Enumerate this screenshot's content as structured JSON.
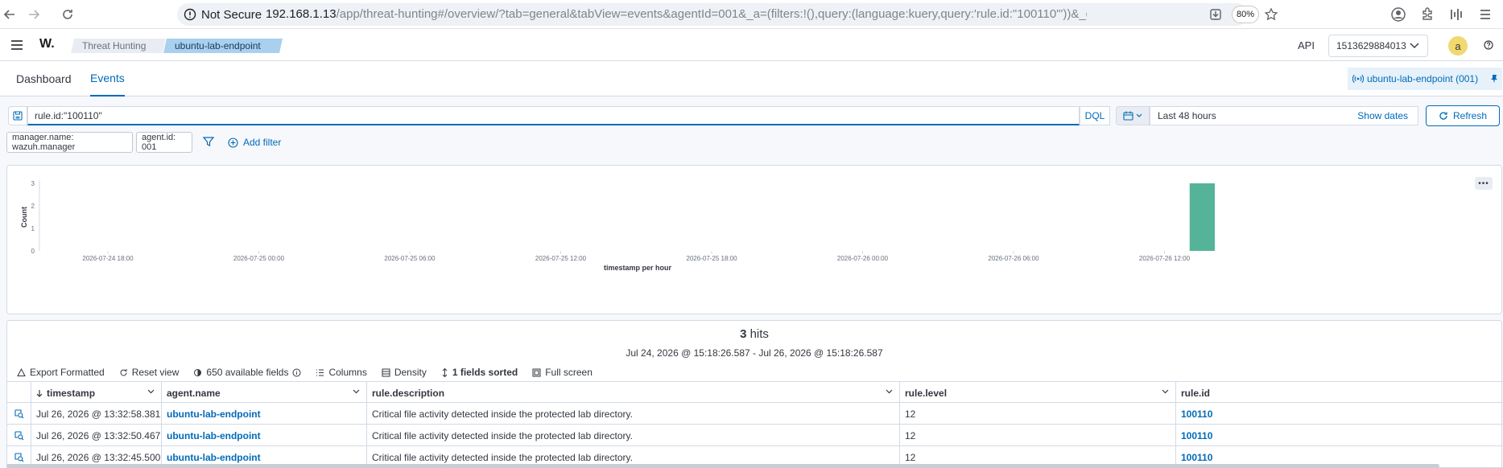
{
  "browser": {
    "security_label": "Not Secure",
    "url_host": "192.168.1.13",
    "url_path": "/app/threat-hunting#/overview/?tab=general&tabView=events&agentId=001&_a=(filters:!(),query:(language:kuery,query:'rule.id:\"100110\"'))&_g=(filters:!(),refreshInterval:(pause:!t",
    "zoom": "80%"
  },
  "header": {
    "logo": "W.",
    "breadcrumbs": [
      "Threat Hunting",
      "ubuntu-lab-endpoint"
    ],
    "api_label": "API",
    "tenant": "1513629884013",
    "avatar_initial": "a"
  },
  "tabs": [
    "Dashboard",
    "Events"
  ],
  "agent_pill": "ubuntu-lab-endpoint (001)",
  "query": {
    "value": "rule.id:\"100110\"",
    "language": "DQL",
    "date_range": "Last 48 hours",
    "show_dates": "Show dates",
    "refresh": "Refresh"
  },
  "filters": [
    "manager.name: wazuh.manager",
    "agent.id: 001"
  ],
  "add_filter": "Add filter",
  "chart_data": {
    "type": "bar",
    "x": [
      "2026-07-26 13:00"
    ],
    "values": [
      3
    ],
    "xlabel": "timestamp per hour",
    "ylabel": "Count",
    "ylim": [
      0,
      3
    ],
    "y_ticks": [
      "0",
      "1",
      "2",
      "3"
    ],
    "x_ticks": [
      "2026-07-24 18:00",
      "2026-07-25 00:00",
      "2026-07-25 06:00",
      "2026-07-25 12:00",
      "2026-07-25 18:00",
      "2026-07-26 00:00",
      "2026-07-26 06:00",
      "2026-07-26 12:00"
    ],
    "bar_color": "#54b399",
    "grid": false
  },
  "results": {
    "hits_count": "3",
    "hits_label": "hits",
    "range": "Jul 24, 2026 @ 15:18:26.587 - Jul 26, 2026 @ 15:18:26.587",
    "toolbar": {
      "export": "Export Formatted",
      "reset": "Reset view",
      "fields": "650 available fields",
      "columns": "Columns",
      "density": "Density",
      "sorted": "1 fields sorted",
      "fullscreen": "Full screen"
    },
    "columns": [
      "timestamp",
      "agent.name",
      "rule.description",
      "rule.level",
      "rule.id"
    ],
    "rows": [
      {
        "timestamp": "Jul 26, 2026 @ 13:32:58.381",
        "agent": "ubuntu-lab-endpoint",
        "description": "Critical file activity detected inside the protected lab directory.",
        "level": "12",
        "rule_id": "100110"
      },
      {
        "timestamp": "Jul 26, 2026 @ 13:32:50.467",
        "agent": "ubuntu-lab-endpoint",
        "description": "Critical file activity detected inside the protected lab directory.",
        "level": "12",
        "rule_id": "100110"
      },
      {
        "timestamp": "Jul 26, 2026 @ 13:32:45.500",
        "agent": "ubuntu-lab-endpoint",
        "description": "Critical file activity detected inside the protected lab directory.",
        "level": "12",
        "rule_id": "100110"
      }
    ]
  }
}
